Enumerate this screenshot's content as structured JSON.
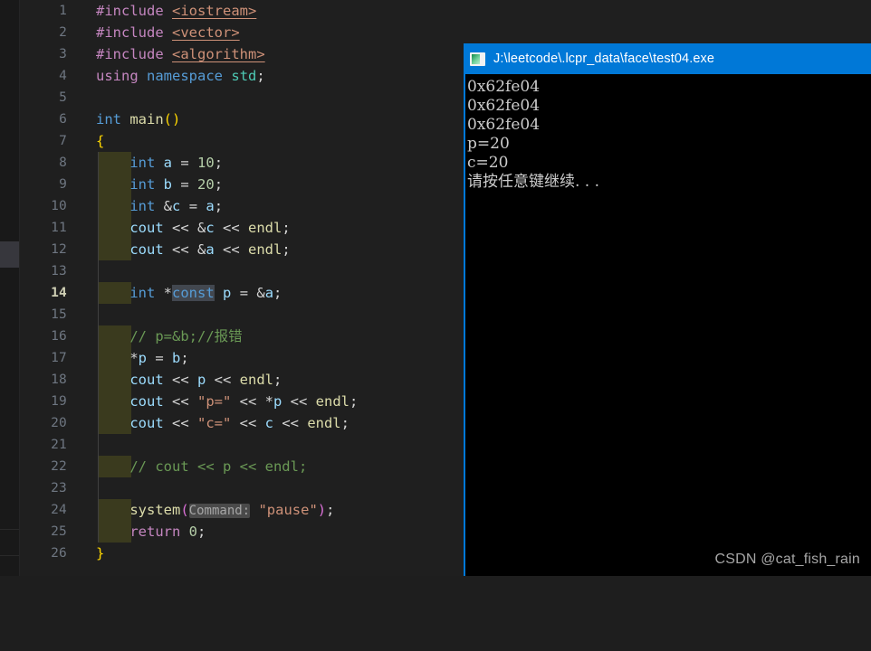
{
  "editor": {
    "theme_background": "#1e1e1e",
    "language": "cpp",
    "current_line": 14,
    "lines": [
      {
        "n": "1",
        "indent_block": false
      },
      {
        "n": "2",
        "indent_block": false
      },
      {
        "n": "3",
        "indent_block": false
      },
      {
        "n": "4",
        "indent_block": false
      },
      {
        "n": "5",
        "indent_block": false
      },
      {
        "n": "6",
        "indent_block": false
      },
      {
        "n": "7",
        "indent_block": false
      },
      {
        "n": "8",
        "indent_block": true
      },
      {
        "n": "9",
        "indent_block": true
      },
      {
        "n": "10",
        "indent_block": true
      },
      {
        "n": "11",
        "indent_block": true
      },
      {
        "n": "12",
        "indent_block": true
      },
      {
        "n": "13",
        "indent_block": false
      },
      {
        "n": "14",
        "indent_block": true
      },
      {
        "n": "15",
        "indent_block": false
      },
      {
        "n": "16",
        "indent_block": true
      },
      {
        "n": "17",
        "indent_block": true
      },
      {
        "n": "18",
        "indent_block": true
      },
      {
        "n": "19",
        "indent_block": true
      },
      {
        "n": "20",
        "indent_block": true
      },
      {
        "n": "21",
        "indent_block": false
      },
      {
        "n": "22",
        "indent_block": true
      },
      {
        "n": "23",
        "indent_block": false
      },
      {
        "n": "24",
        "indent_block": true
      },
      {
        "n": "25",
        "indent_block": true
      },
      {
        "n": "26",
        "indent_block": false
      }
    ],
    "code": {
      "l1_include": "#include",
      "l1_header": "<iostream>",
      "l2_include": "#include",
      "l2_header": "<vector>",
      "l3_include": "#include",
      "l3_header": "<algorithm>",
      "l4_using": "using",
      "l4_namespace": "namespace",
      "l4_std": "std",
      "l4_semi": ";",
      "l6_int": "int",
      "l6_main": "main",
      "l6_parens": "()",
      "l7_brace": "{",
      "l8_int": "int",
      "l8_var": "a",
      "l8_eq": " = ",
      "l8_num": "10",
      "l8_semi": ";",
      "l9_int": "int",
      "l9_var": "b",
      "l9_eq": " = ",
      "l9_num": "20",
      "l9_semi": ";",
      "l10_int": "int",
      "l10_amp": "&",
      "l10_var": "c",
      "l10_eq": " = ",
      "l10_rhs": "a",
      "l10_semi": ";",
      "l11_cout": "cout",
      "l11_shift1": " << ",
      "l11_amp": "&",
      "l11_var": "c",
      "l11_shift2": " << ",
      "l11_endl": "endl",
      "l11_semi": ";",
      "l12_cout": "cout",
      "l12_shift1": " << ",
      "l12_amp": "&",
      "l12_var": "a",
      "l12_shift2": " << ",
      "l12_endl": "endl",
      "l12_semi": ";",
      "l14_int": "int",
      "l14_star": " *",
      "l14_const": "const",
      "l14_p": "p",
      "l14_eq": " = ",
      "l14_amp": "&",
      "l14_a": "a",
      "l14_semi": ";",
      "l16_comment": "// p=&b;//报错",
      "l17_star": "*",
      "l17_p": "p",
      "l17_eq": " = ",
      "l17_b": "b",
      "l17_semi": ";",
      "l18_cout": "cout",
      "l18_shift1": " << ",
      "l18_p": "p",
      "l18_shift2": " << ",
      "l18_endl": "endl",
      "l18_semi": ";",
      "l19_cout": "cout",
      "l19_shift1": " << ",
      "l19_str": "\"p=\"",
      "l19_shift2": " << ",
      "l19_star": "*",
      "l19_p": "p",
      "l19_shift3": " << ",
      "l19_endl": "endl",
      "l19_semi": ";",
      "l20_cout": "cout",
      "l20_shift1": " << ",
      "l20_str": "\"c=\"",
      "l20_shift2": " << ",
      "l20_c": "c",
      "l20_shift3": " << ",
      "l20_endl": "endl",
      "l20_semi": ";",
      "l22_comment": "// cout << p << endl;",
      "l24_system": "system",
      "l24_lparen": "(",
      "l24_hint": "Command:",
      "l24_str": "\"pause\"",
      "l24_rparen": ")",
      "l24_semi": ";",
      "l25_return": "return",
      "l25_num": " 0",
      "l25_semi": ";",
      "l26_brace": "}"
    }
  },
  "console": {
    "title": "J:\\leetcode\\.lcpr_data\\face\\test04.exe",
    "icon": "console-window-icon",
    "titlebar_color": "#0078D7",
    "background_color": "#000000",
    "output": [
      "0x62fe04",
      "0x62fe04",
      "0x62fe04",
      "p=20",
      "c=20",
      "请按任意键继续. . ."
    ]
  },
  "watermark": {
    "text": "CSDN @cat_fish_rain"
  }
}
